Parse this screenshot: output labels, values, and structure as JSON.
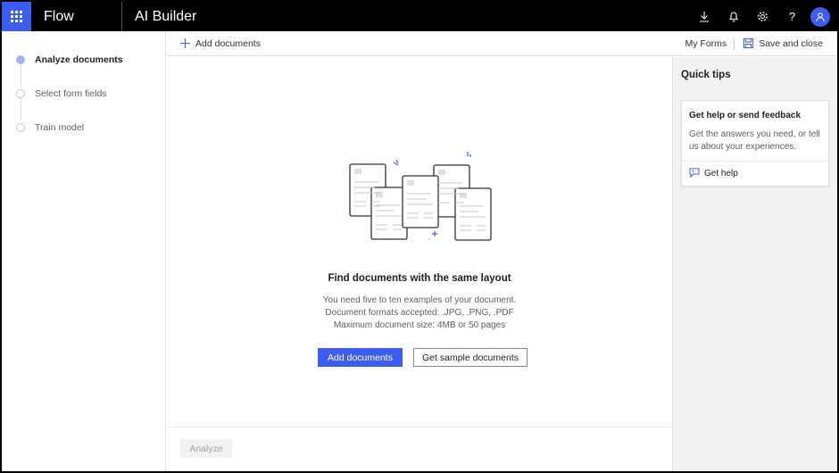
{
  "topbar": {
    "app_name": "Flow",
    "product_name": "AI Builder",
    "icons": [
      "waffle-icon",
      "download-icon",
      "bell-icon",
      "gear-icon",
      "help-icon",
      "user-icon"
    ],
    "help_glyph": "?"
  },
  "stepper": {
    "steps": [
      {
        "label": "Analyze documents",
        "active": true
      },
      {
        "label": "Select form fields",
        "active": false
      },
      {
        "label": "Train model",
        "active": false
      }
    ]
  },
  "commandbar": {
    "add_label": "Add documents",
    "my_forms_label": "My Forms",
    "save_label": "Save and close"
  },
  "main": {
    "title": "Find documents with the same layout",
    "desc_lines": [
      "You need five to ten examples of your document.",
      "Document formats accepted: .JPG, .PNG, .PDF",
      "Maximum document size: 4MB or 50 pages"
    ],
    "primary_button": "Add documents",
    "secondary_button": "Get sample documents"
  },
  "footer": {
    "analyze_label": "Analyze"
  },
  "quick_tips": {
    "title": "Quick tips",
    "card_title": "Get help or send feedback",
    "card_body": "Get the answers you need, or tell us about your experiences.",
    "card_link": "Get help"
  },
  "colors": {
    "accent": "#3c5df0",
    "topbar": "#000000",
    "pane": "#f3f2f1"
  }
}
